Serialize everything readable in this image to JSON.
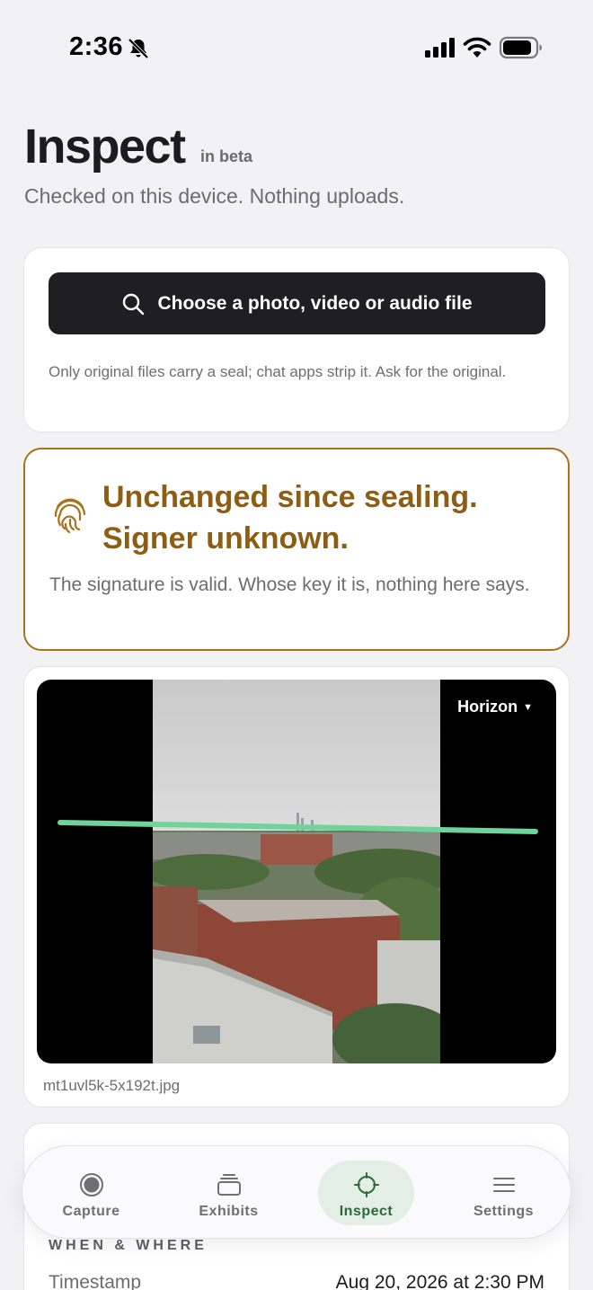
{
  "status_bar": {
    "time": "2:36"
  },
  "header": {
    "title": "Inspect",
    "beta": "in beta",
    "subtitle": "Checked on this device. Nothing uploads."
  },
  "choose": {
    "button_label": "Choose a photo, video or audio file",
    "hint": "Only original files carry a seal; chat apps strip it. Ask for the original."
  },
  "verdict": {
    "title_line1": "Unchanged since sealing.",
    "title_line2": "Signer unknown.",
    "description": "The signature is valid. Whose key it is, nothing here says.",
    "color": "#8d5d14",
    "border_color": "#a7721a"
  },
  "media": {
    "overlay_select": "Horizon",
    "filename": "mt1uvl5k-5x192t.jpg",
    "horizon_color": "#6fd39a"
  },
  "details": {
    "heading": "WHEN & WHERE",
    "rows": [
      {
        "label": "Timestamp",
        "value": "Aug 20, 2026 at 2:30 PM"
      }
    ]
  },
  "tabs": [
    {
      "label": "Capture",
      "icon": "record-icon",
      "active": false
    },
    {
      "label": "Exhibits",
      "icon": "stack-icon",
      "active": false
    },
    {
      "label": "Inspect",
      "icon": "crosshair-icon",
      "active": true
    },
    {
      "label": "Settings",
      "icon": "menu-icon",
      "active": false
    }
  ],
  "colors": {
    "accent_active_tab": "#2d6a3a",
    "active_tab_bg": "#e3efe6",
    "button_bg": "#1f1f21"
  }
}
